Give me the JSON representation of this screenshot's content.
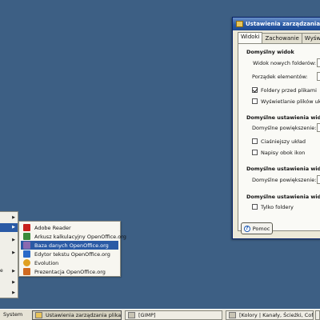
{
  "dialog": {
    "title": "Ustawienia zarządzania pl",
    "tabs": [
      {
        "label": "Widoki",
        "active": true
      },
      {
        "label": "Zachowanie",
        "active": false
      },
      {
        "label": "Wyświetla",
        "active": false
      }
    ],
    "sections": {
      "default_view": {
        "heading": "Domyślny widok",
        "new_folders_label": "Widok nowych folderów:",
        "order_label": "Porządek elementów:",
        "folders_first": {
          "label": "Foldery przed plikami",
          "checked": true
        },
        "hidden_files": {
          "label": "Wyświetlanie plików ukr",
          "checked": false
        }
      },
      "icon_view": {
        "heading": "Domyślne ustawienia wido",
        "zoom_label": "Domyślne powiększenie:",
        "compact": {
          "label": "Ciaśniejszy układ",
          "checked": false
        },
        "text_beside": {
          "label": "Napisy obok ikon",
          "checked": false
        }
      },
      "list_view": {
        "heading": "Domyślne ustawienia wido",
        "zoom_label": "Domyślne powiększenie:"
      },
      "tree_view": {
        "heading": "Domyślne ustawienia wido",
        "only_folders": {
          "label": "Tylko foldery",
          "checked": false
        }
      }
    },
    "help_button": "Pomoc"
  },
  "submenu": {
    "items": [
      {
        "label": "Adobe Reader",
        "icon": "adobe-reader-icon",
        "color": "#c8201c",
        "highlighted": false
      },
      {
        "label": "Arkusz kalkulacyjny OpenOffice.org",
        "icon": "spreadsheet-icon",
        "color": "#3a8a3a",
        "highlighted": false
      },
      {
        "label": "Baza danych OpenOffice.org",
        "icon": "database-icon",
        "color": "#8a6ab0",
        "highlighted": true
      },
      {
        "label": "Edytor tekstu OpenOffice.org",
        "icon": "writer-icon",
        "color": "#2a6ac8",
        "highlighted": false
      },
      {
        "label": "Evolution",
        "icon": "evolution-icon",
        "color": "#e0a020",
        "highlighted": false
      },
      {
        "label": "Prezentacja OpenOffice.org",
        "icon": "presentation-icon",
        "color": "#d06a20",
        "highlighted": false
      }
    ]
  },
  "menu_col": {
    "fragment_e": "e"
  },
  "taskbar": {
    "system_label": "System",
    "buttons": [
      {
        "label": "Ustawienia zarządzania plikami",
        "active": true
      },
      {
        "label": "[GIMP]",
        "active": false
      },
      {
        "label": "[Kolory | Kanały, Ścieżki, Cof...",
        "active": false
      }
    ]
  },
  "colors": {
    "desktop": "#3d5f84",
    "titlebar": "#2a5aa5",
    "highlight": "#2a5aa5"
  }
}
